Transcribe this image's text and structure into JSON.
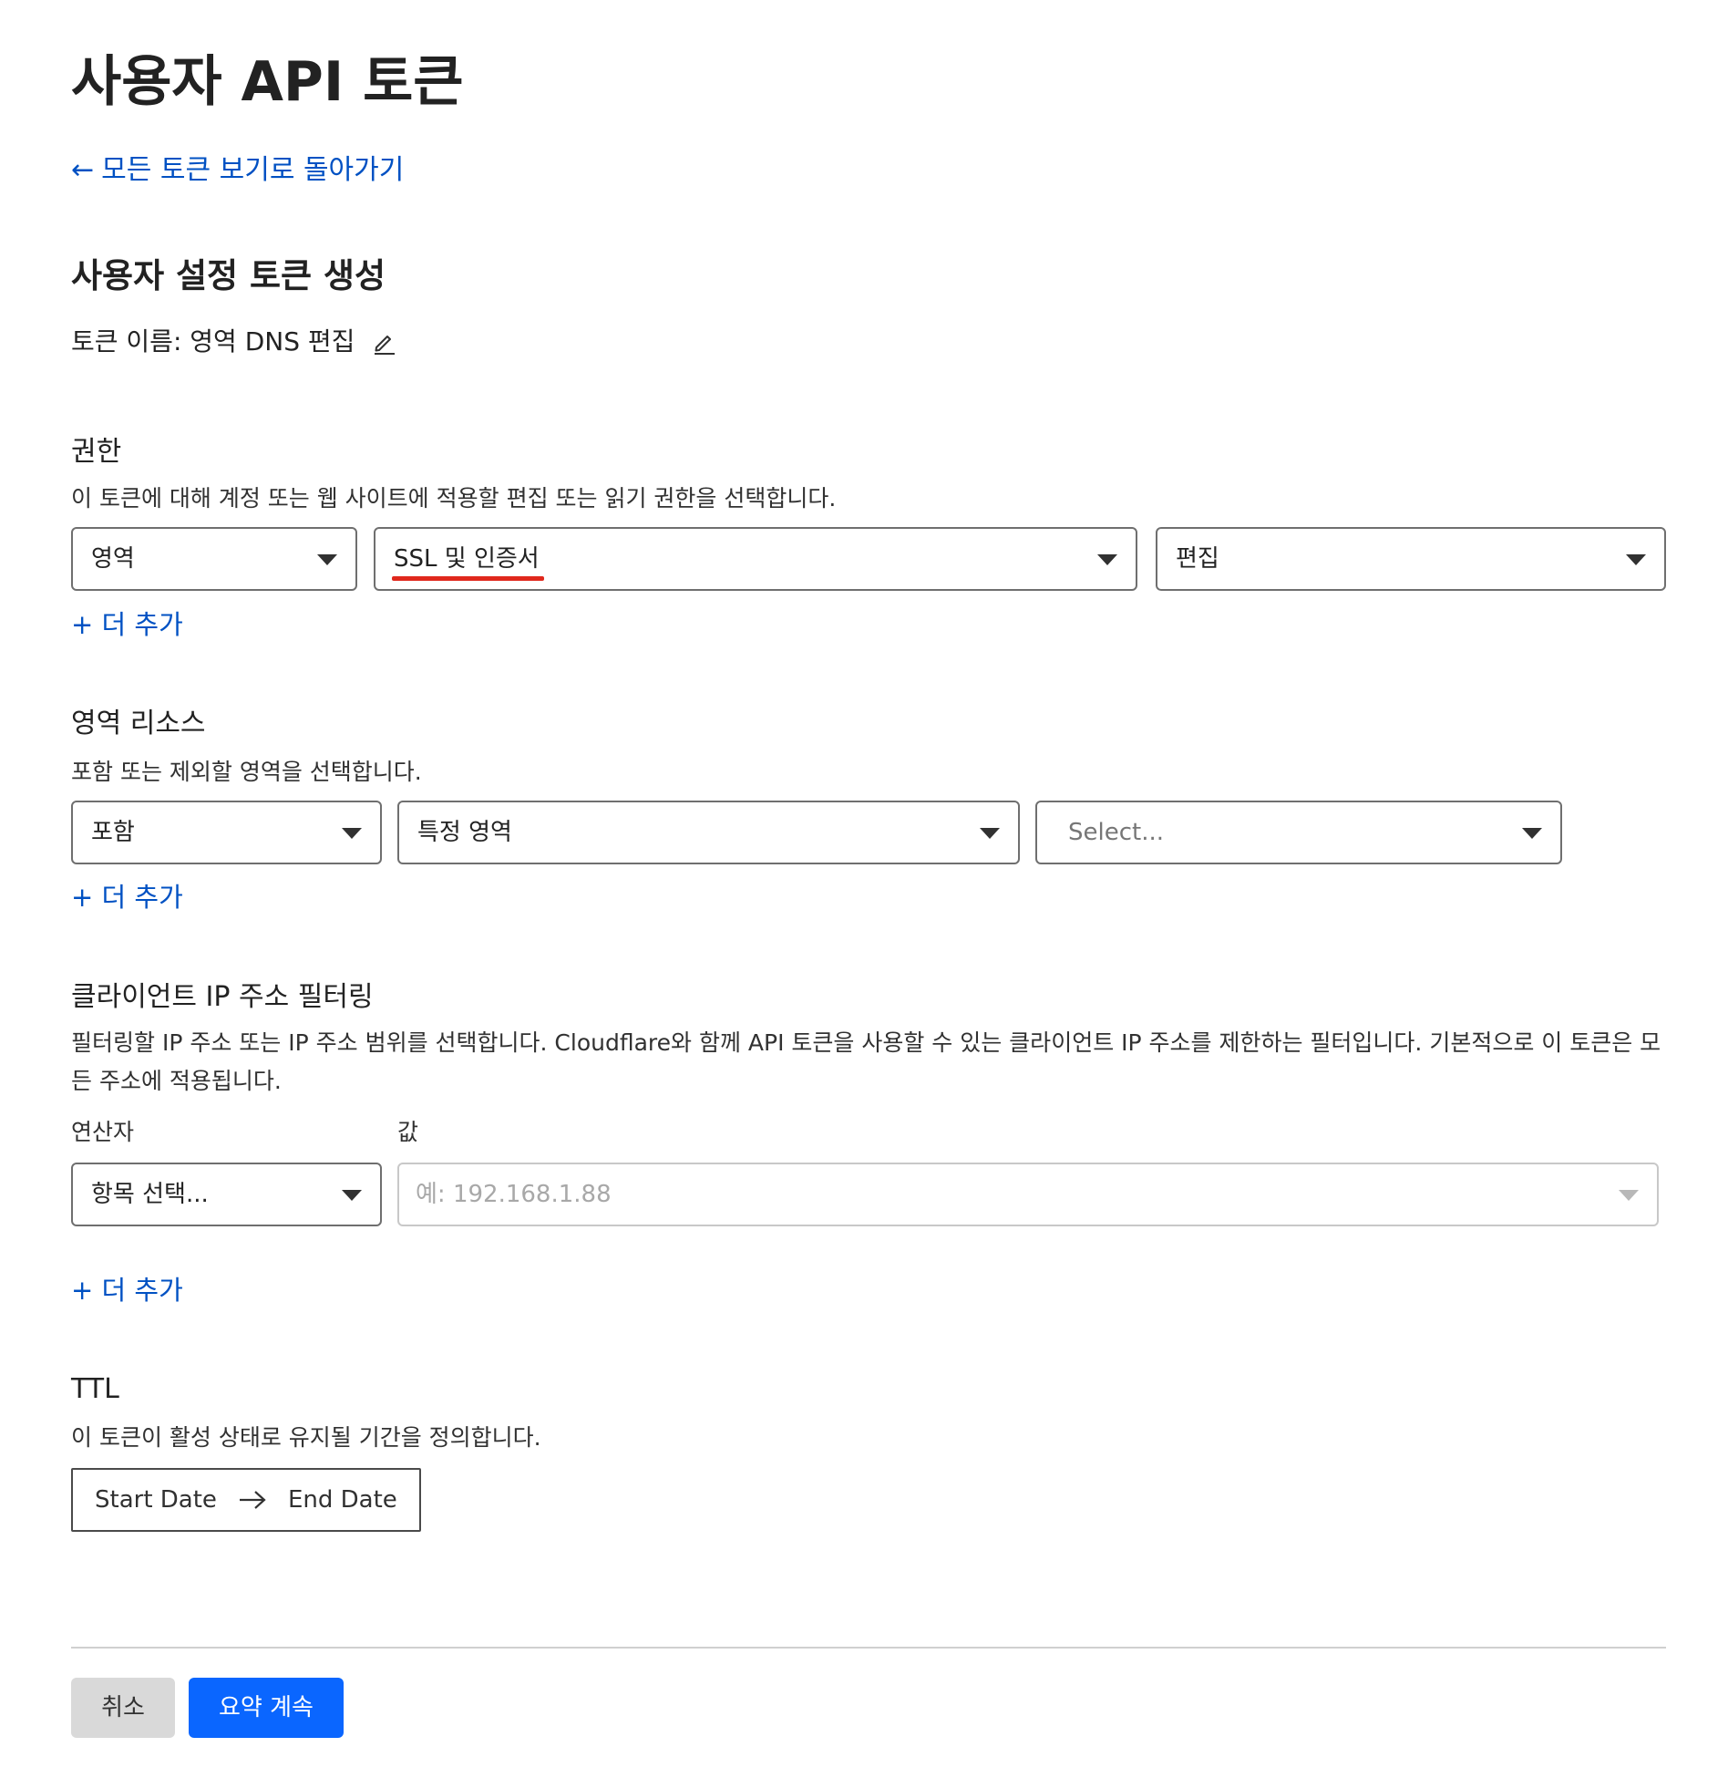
{
  "page": {
    "title": "사용자 API 토큰",
    "back_link": "모든 토큰 보기로 돌아가기",
    "section_heading": "사용자 설정 토큰 생성",
    "token_name": "토큰 이름: 영역 DNS 편집"
  },
  "permissions": {
    "title": "권한",
    "description": "이 토큰에 대해 계정 또는 웹 사이트에 적용할 편집 또는 읽기 권한을 선택합니다.",
    "scope_select": "영역",
    "resource_select": "SSL 및 인증서",
    "access_select": "편집",
    "add_more": "+ 더 추가"
  },
  "zone_resources": {
    "title": "영역 리소스",
    "description": "포함 또는 제외할 영역을 선택합니다.",
    "include_select": "포함",
    "zone_type_select": "특정 영역",
    "zone_select_placeholder": "Select...",
    "add_more": "+ 더 추가"
  },
  "ip_filtering": {
    "title": "클라이언트 IP 주소 필터링",
    "description": "필터링할 IP 주소 또는 IP 주소 범위를 선택합니다. Cloudflare와 함께 API 토큰을 사용할 수 있는 클라이언트 IP 주소를 제한하는 필터입니다. 기본적으로 이 토큰은 모든 주소에 적용됩니다.",
    "operator_label": "연산자",
    "value_label": "값",
    "operator_select": "항목 선택...",
    "value_placeholder": "예: 192.168.1.88",
    "add_more": "+ 더 추가"
  },
  "ttl": {
    "title": "TTL",
    "description": "이 토큰이 활성 상태로 유지될 기간을 정의합니다.",
    "start_date": "Start Date",
    "end_date": "End Date"
  },
  "footer": {
    "cancel": "취소",
    "continue": "요약 계속"
  },
  "colors": {
    "link": "#0051c3",
    "primary_button": "#0a66ff",
    "highlight_underline": "#e0281c"
  }
}
